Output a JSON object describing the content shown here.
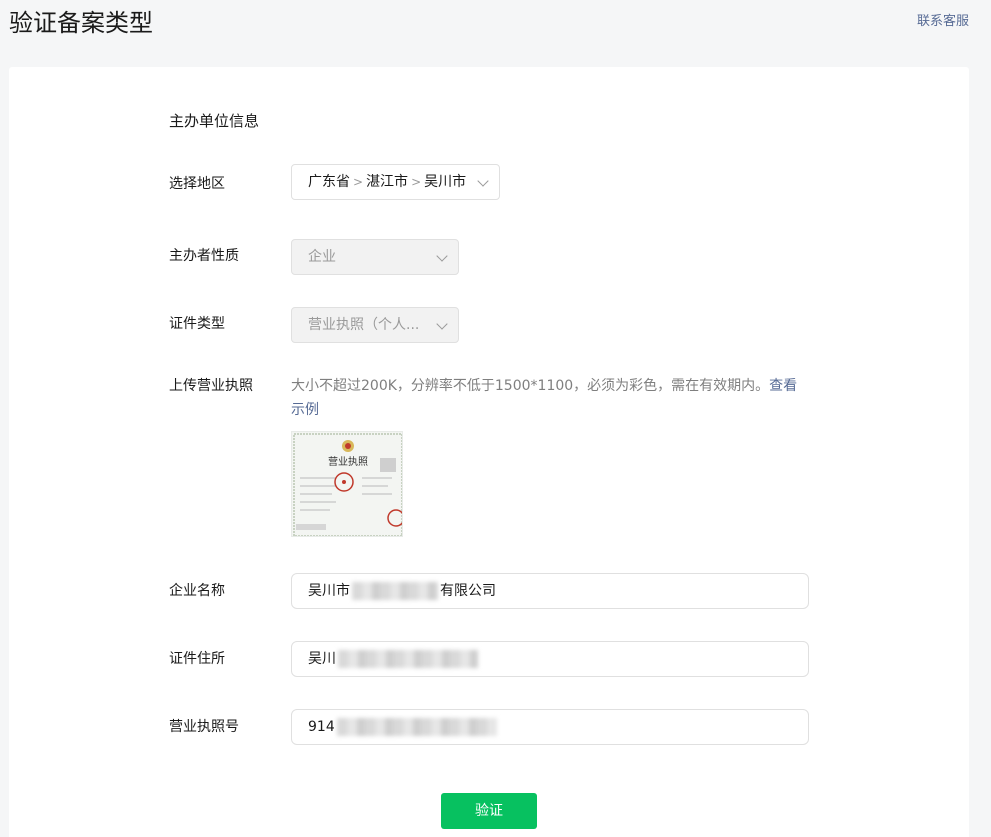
{
  "header": {
    "title": "验证备案类型",
    "contact_link": "联系客服"
  },
  "form": {
    "section_title": "主办单位信息",
    "region": {
      "label": "选择地区",
      "parts": [
        "广东省",
        "湛江市",
        "吴川市"
      ],
      "separator": ">"
    },
    "organizer_type": {
      "label": "主办者性质",
      "value": "企业"
    },
    "certificate_type": {
      "label": "证件类型",
      "value": "营业执照（个人..."
    },
    "upload": {
      "label": "上传营业执照",
      "hint": "大小不超过200K，分辨率不低于1500*1100，必须为彩色，需在有效期内。",
      "example_link": "查看示例",
      "thumbnail_title": "营业执照"
    },
    "company_name": {
      "label": "企业名称",
      "value_prefix": "吴川市",
      "value_suffix": "有限公司"
    },
    "address": {
      "label": "证件住所",
      "value_prefix": "吴川"
    },
    "license_number": {
      "label": "营业执照号",
      "value_prefix": "914"
    },
    "submit_label": "验证"
  },
  "colors": {
    "accent": "#07c160",
    "link": "#576b95",
    "background": "#f5f6f7"
  }
}
